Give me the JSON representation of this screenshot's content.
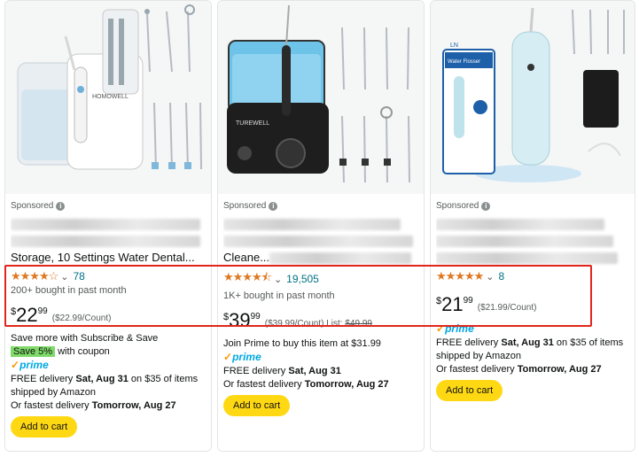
{
  "products": [
    {
      "sponsored": "Sponsored",
      "title_lines": [
        "",
        "",
        "Storage, 10 Settings Water Dental..."
      ],
      "rating_count": "78",
      "bought": "200+ bought in past month",
      "price_symbol": "$",
      "price_whole": "22",
      "price_fraction": "99",
      "unit_price": "($22.99/Count)",
      "promo_text": "Save more with Subscribe & Save",
      "save_badge": "Save 5%",
      "coupon_text": "with coupon",
      "prime": "prime",
      "delivery_prefix": "FREE delivery ",
      "delivery_date": "Sat, Aug 31",
      "delivery_suffix": " on $35 of items",
      "shipped": "shipped by Amazon",
      "fastest_prefix": "Or fastest delivery ",
      "fastest_date": "Tomorrow, Aug 27",
      "add_to_cart": "Add to cart",
      "stars": 4
    },
    {
      "sponsored": "Sponsored",
      "title_lines": [
        "",
        "",
        "Cleane..."
      ],
      "rating_count": "19,505",
      "bought": "1K+ bought in past month",
      "price_symbol": "$",
      "price_whole": "39",
      "price_fraction": "99",
      "unit_price": "($39.99/Count)",
      "list_price_label": "List: ",
      "list_price": "$49.99",
      "prime_offer": "Join Prime to buy this item at $31.99",
      "prime": "prime",
      "delivery_prefix": "FREE delivery ",
      "delivery_date": "Sat, Aug 31",
      "fastest_prefix": "Or fastest delivery ",
      "fastest_date": "Tomorrow, Aug 27",
      "add_to_cart": "Add to cart",
      "stars": 4.5
    },
    {
      "sponsored": "Sponsored",
      "title_lines": [
        "",
        "",
        ""
      ],
      "rating_count": "8",
      "price_symbol": "$",
      "price_whole": "21",
      "price_fraction": "99",
      "unit_price": "($21.99/Count)",
      "prime": "prime",
      "delivery_prefix": "FREE delivery ",
      "delivery_date": "Sat, Aug 31",
      "delivery_suffix": " on $35 of items",
      "shipped": "shipped by Amazon",
      "fastest_prefix": "Or fastest delivery ",
      "fastest_date": "Tomorrow, Aug 27",
      "add_to_cart": "Add to cart",
      "stars": 5
    }
  ],
  "image_text": {
    "p1_brand": "HOMOWELL",
    "p2_brand": "TUREWELL",
    "p3_box": "Water Flosser",
    "p3_logo": "LN"
  },
  "colors": {
    "star": "#de7921",
    "link": "#007185",
    "add_to_cart": "#ffd814",
    "highlight": "#e1251b",
    "prime": "#00a8e1"
  }
}
